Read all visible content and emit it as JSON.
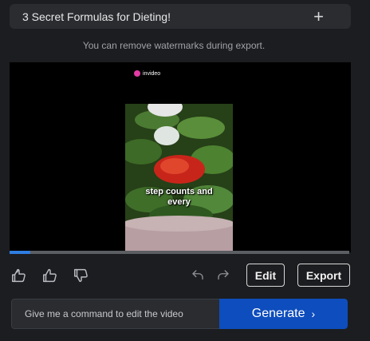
{
  "header": {
    "title": "3 Secret Formulas for Dieting!",
    "add_icon": "plus-icon"
  },
  "notice": "You can remove watermarks during export.",
  "player": {
    "brand": "invideo",
    "caption": "step counts and every",
    "progress": 0.06
  },
  "actions": {
    "feedback_icons": [
      "thumbs-up-double-icon",
      "thumbs-up-icon",
      "thumbs-down-icon"
    ],
    "undo_icon": "undo-icon",
    "redo_icon": "redo-icon",
    "edit_label": "Edit",
    "export_label": "Export"
  },
  "command": {
    "placeholder": "Give me a command to edit the video",
    "generate_label": "Generate",
    "generate_icon": "chevron-right-icon"
  },
  "colors": {
    "background": "#1c1d20",
    "accent": "#0e4dbd",
    "progress": "#2f7de1"
  }
}
